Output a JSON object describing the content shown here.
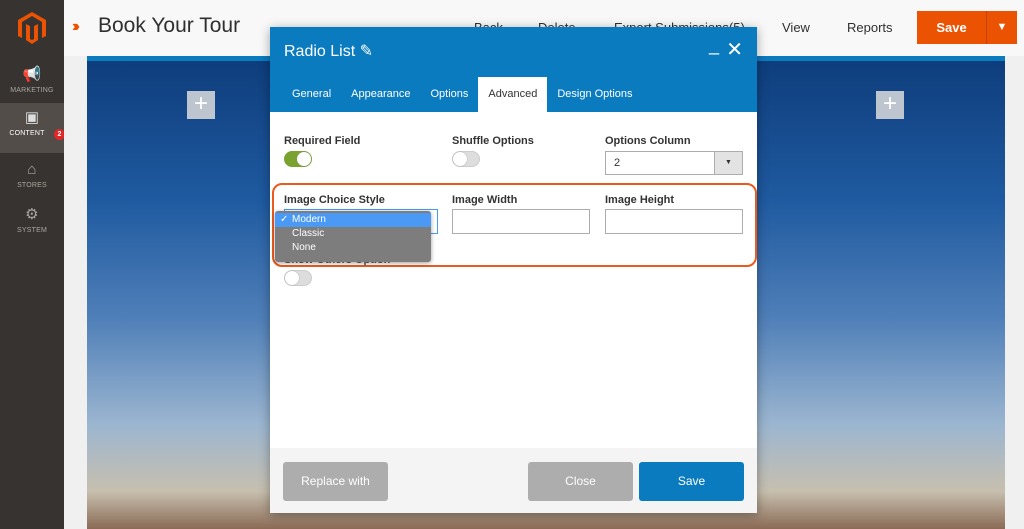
{
  "sidebar": {
    "items": [
      {
        "label": "MARKETING",
        "icon": "megaphone-icon"
      },
      {
        "label": "CONTENT",
        "icon": "layout-icon",
        "badge": "2"
      },
      {
        "label": "STORES",
        "icon": "store-icon"
      },
      {
        "label": "SYSTEM",
        "icon": "gear-icon"
      }
    ]
  },
  "header": {
    "title": "Book Your Tour",
    "links": {
      "back": "Back",
      "delete": "Delete",
      "export": "Export Submissions(5)",
      "view": "View",
      "reports": "Reports"
    },
    "save": "Save"
  },
  "modal": {
    "title": "Radio List",
    "tabs": [
      "General",
      "Appearance",
      "Options",
      "Advanced",
      "Design Options"
    ],
    "active_tab": "Advanced",
    "fields": {
      "required": {
        "label": "Required Field",
        "on": true
      },
      "shuffle": {
        "label": "Shuffle Options",
        "on": false
      },
      "columns": {
        "label": "Options Column",
        "value": "2"
      },
      "image_style": {
        "label": "Image Choice Style",
        "options": [
          "Modern",
          "Classic",
          "None"
        ],
        "selected": "Modern"
      },
      "image_width": {
        "label": "Image Width",
        "value": ""
      },
      "image_height": {
        "label": "Image Height",
        "value": ""
      },
      "show_others": {
        "label": "Show Others Option",
        "on": false
      }
    },
    "footer": {
      "replace": "Replace with",
      "close": "Close",
      "save": "Save"
    }
  },
  "colors": {
    "accent": "#eb5202",
    "modal_header": "#0a7bbf",
    "toggle_on": "#79a22e"
  }
}
